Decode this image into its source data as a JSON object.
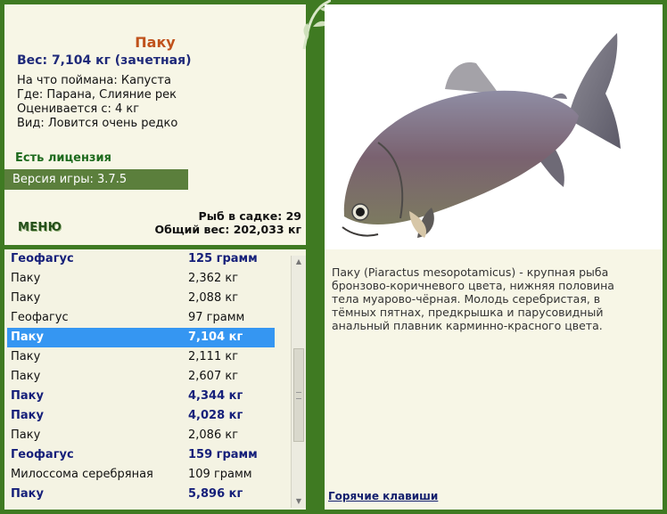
{
  "fish": {
    "name": "Паку",
    "weight": "Вес: 7,104 кг (зачетная)",
    "bait": "На что поймана: Капуста",
    "location": "Где: Парана, Слияние рек",
    "value": "Оценивается с: 4 кг",
    "rarity": "Вид: Ловится очень редко"
  },
  "license": "Есть лицензия",
  "version": "Версия игры: 3.7.5",
  "menu_label": "МЕНЮ",
  "stats": {
    "cage_count": "Рыб в садке: 29",
    "total_weight": "Общий вес: 202,033 кг"
  },
  "catch_list": [
    {
      "name": "Геофагус",
      "weight": "125 грамм",
      "bold": true,
      "selected": false
    },
    {
      "name": "Паку",
      "weight": "2,362 кг",
      "bold": false,
      "selected": false
    },
    {
      "name": "Паку",
      "weight": "2,088 кг",
      "bold": false,
      "selected": false
    },
    {
      "name": "Геофагус",
      "weight": "97 грамм",
      "bold": false,
      "selected": false
    },
    {
      "name": "Паку",
      "weight": "7,104 кг",
      "bold": true,
      "selected": true
    },
    {
      "name": "Паку",
      "weight": "2,111 кг",
      "bold": false,
      "selected": false
    },
    {
      "name": "Паку",
      "weight": "2,607 кг",
      "bold": false,
      "selected": false
    },
    {
      "name": "Паку",
      "weight": "4,344 кг",
      "bold": true,
      "selected": false
    },
    {
      "name": "Паку",
      "weight": "4,028 кг",
      "bold": true,
      "selected": false
    },
    {
      "name": "Паку",
      "weight": "2,086 кг",
      "bold": false,
      "selected": false
    },
    {
      "name": "Геофагус",
      "weight": "159 грамм",
      "bold": true,
      "selected": false
    },
    {
      "name": "Милоссома серебряная",
      "weight": "109 грамм",
      "bold": false,
      "selected": false
    },
    {
      "name": "Паку",
      "weight": "5,896 кг",
      "bold": true,
      "selected": false
    }
  ],
  "description": "Паку (Piaractus mesopotamicus) - крупная рыба бронзово-коричневого цвета, нижняя половина тела муарово-чёрная. Молодь серебристая, в тёмных пятнах, предкрышка и парусовидный анальный плавник карминно-красного цвета.",
  "hotkeys_label": "Горячие клавиши",
  "colors": {
    "frame": "#3f7a22",
    "panel": "#f7f6e6",
    "selected": "#3596f2",
    "title": "#c0521c",
    "heavy_catch": "#16207a"
  }
}
